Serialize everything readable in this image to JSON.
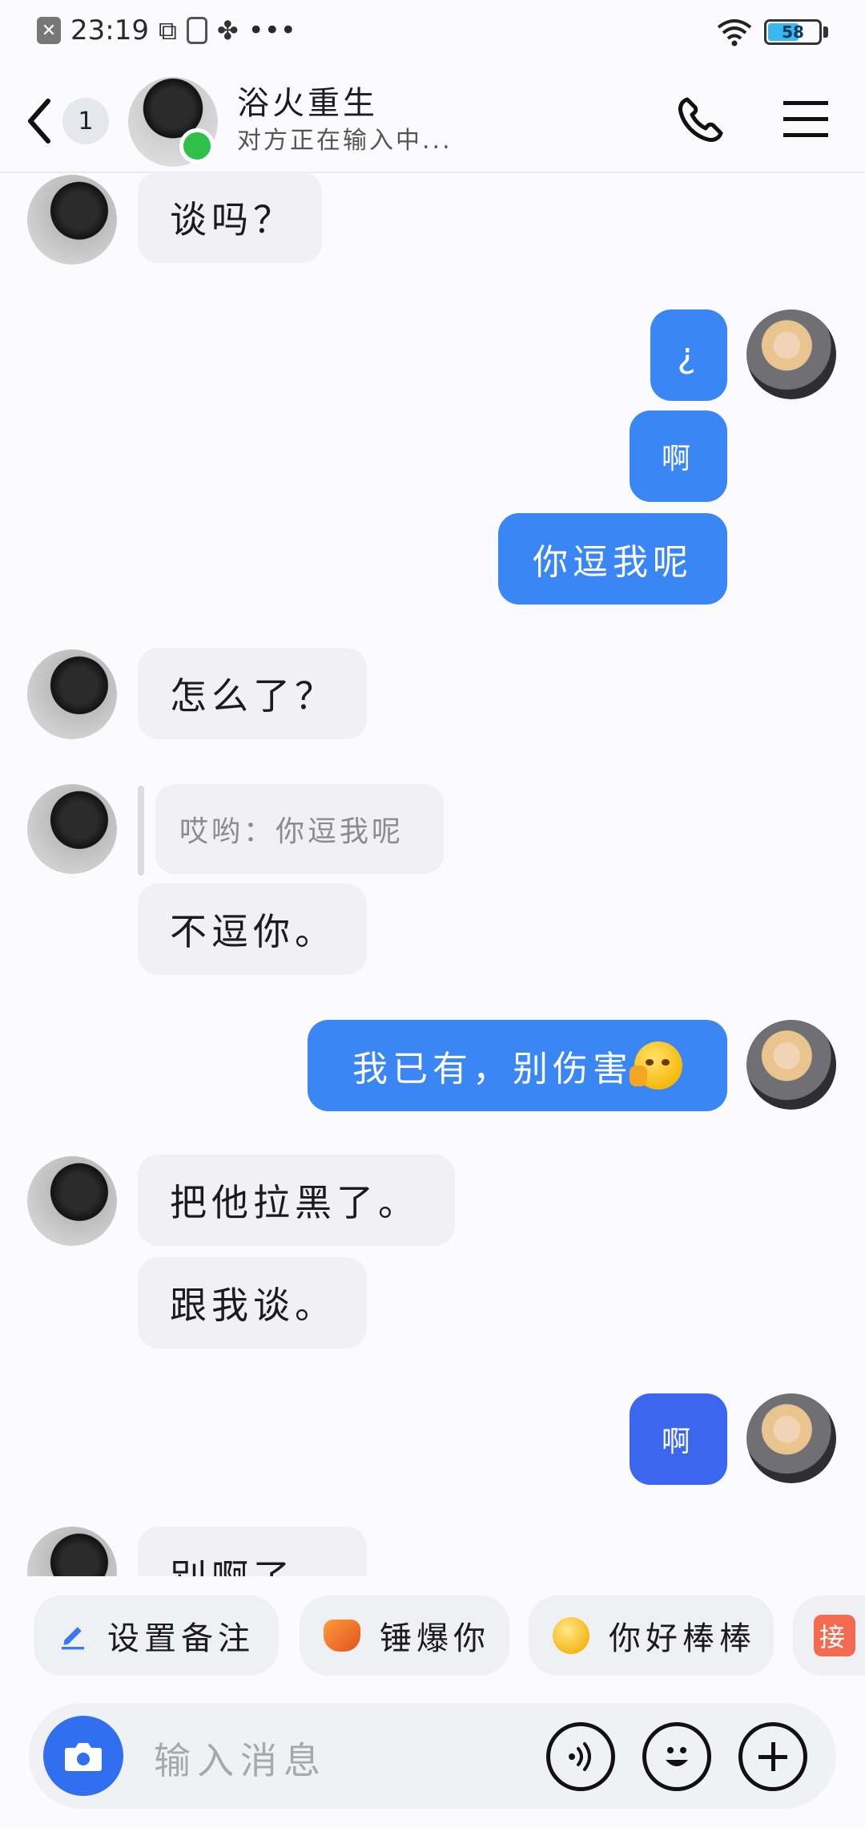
{
  "status_bar": {
    "time": "23:19",
    "battery": "58",
    "more": "•••"
  },
  "header": {
    "unread_count": "1",
    "contact_name": "浴火重生",
    "typing_status": "对方正在输入中..."
  },
  "messages": {
    "m0": "谈吗？",
    "m1": "¿",
    "m2": "啊",
    "m3": "你逗我呢",
    "m4": "怎么了？",
    "m5_quote": "哎哟：你逗我呢",
    "m5": "不逗你。",
    "m6": "我已有，别伤害",
    "m7": "把他拉黑了。",
    "m8": "跟我谈。",
    "m9": "啊",
    "m10": "别啊了"
  },
  "quick_replies": {
    "set_note": "设置备注",
    "hammer": "锤爆你",
    "great": "你好棒棒",
    "receive": "接"
  },
  "input": {
    "placeholder": "输入消息"
  },
  "colors": {
    "out_bubble": "#3a86f5",
    "out_bubble_dark": "#3a67ee",
    "camera": "#2f6ff0",
    "online": "#2fc04a"
  }
}
